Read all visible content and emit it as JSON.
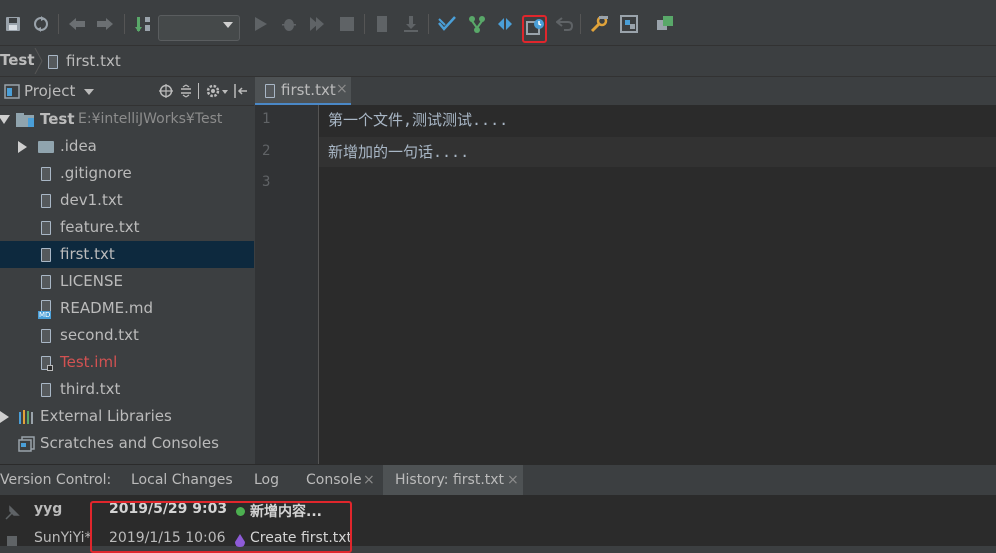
{
  "toolbar": {
    "save_icon": "save-icon",
    "sync_icon": "sync-icon",
    "config_combo_value": ""
  },
  "breadcrumb": {
    "root": "Test",
    "file": "first.txt"
  },
  "project_panel": {
    "title": "Project"
  },
  "tree": {
    "root_name": "Test",
    "root_path": "E:¥intelliJWorks¥Test",
    "items": [
      {
        "label": ".idea"
      },
      {
        "label": ".gitignore"
      },
      {
        "label": "dev1.txt"
      },
      {
        "label": "feature.txt"
      },
      {
        "label": "first.txt"
      },
      {
        "label": "LICENSE"
      },
      {
        "label": "README.md"
      },
      {
        "label": "second.txt"
      },
      {
        "label": "Test.iml"
      },
      {
        "label": "third.txt"
      },
      {
        "label": "External Libraries"
      },
      {
        "label": "Scratches and Consoles"
      }
    ],
    "md_badge": "MD"
  },
  "editor": {
    "tab_label": "first.txt",
    "tab_close": "×",
    "line_numbers": [
      "1",
      "2",
      "3"
    ],
    "lines": [
      "第一个文件,测试测试....",
      "新增加的一句话....",
      ""
    ]
  },
  "bottom": {
    "label": "Version Control:",
    "tabs": [
      {
        "label": "Local Changes"
      },
      {
        "label": "Log"
      },
      {
        "label": "Console"
      },
      {
        "label": "History: first.txt"
      }
    ],
    "close": "×",
    "history": [
      {
        "author": "yyg",
        "date": "2019/5/29 9:03",
        "message": "新增内容..."
      },
      {
        "author": "SunYiYi*",
        "date": "2019/1/15 10:06",
        "message": "Create first.txt"
      }
    ]
  },
  "colors": {
    "accent_red": "#e0262c",
    "selection": "#0d293e",
    "ignored_file": "#d25252",
    "green_commit": "#4caf50",
    "purple_commit": "#8e5bd8"
  }
}
